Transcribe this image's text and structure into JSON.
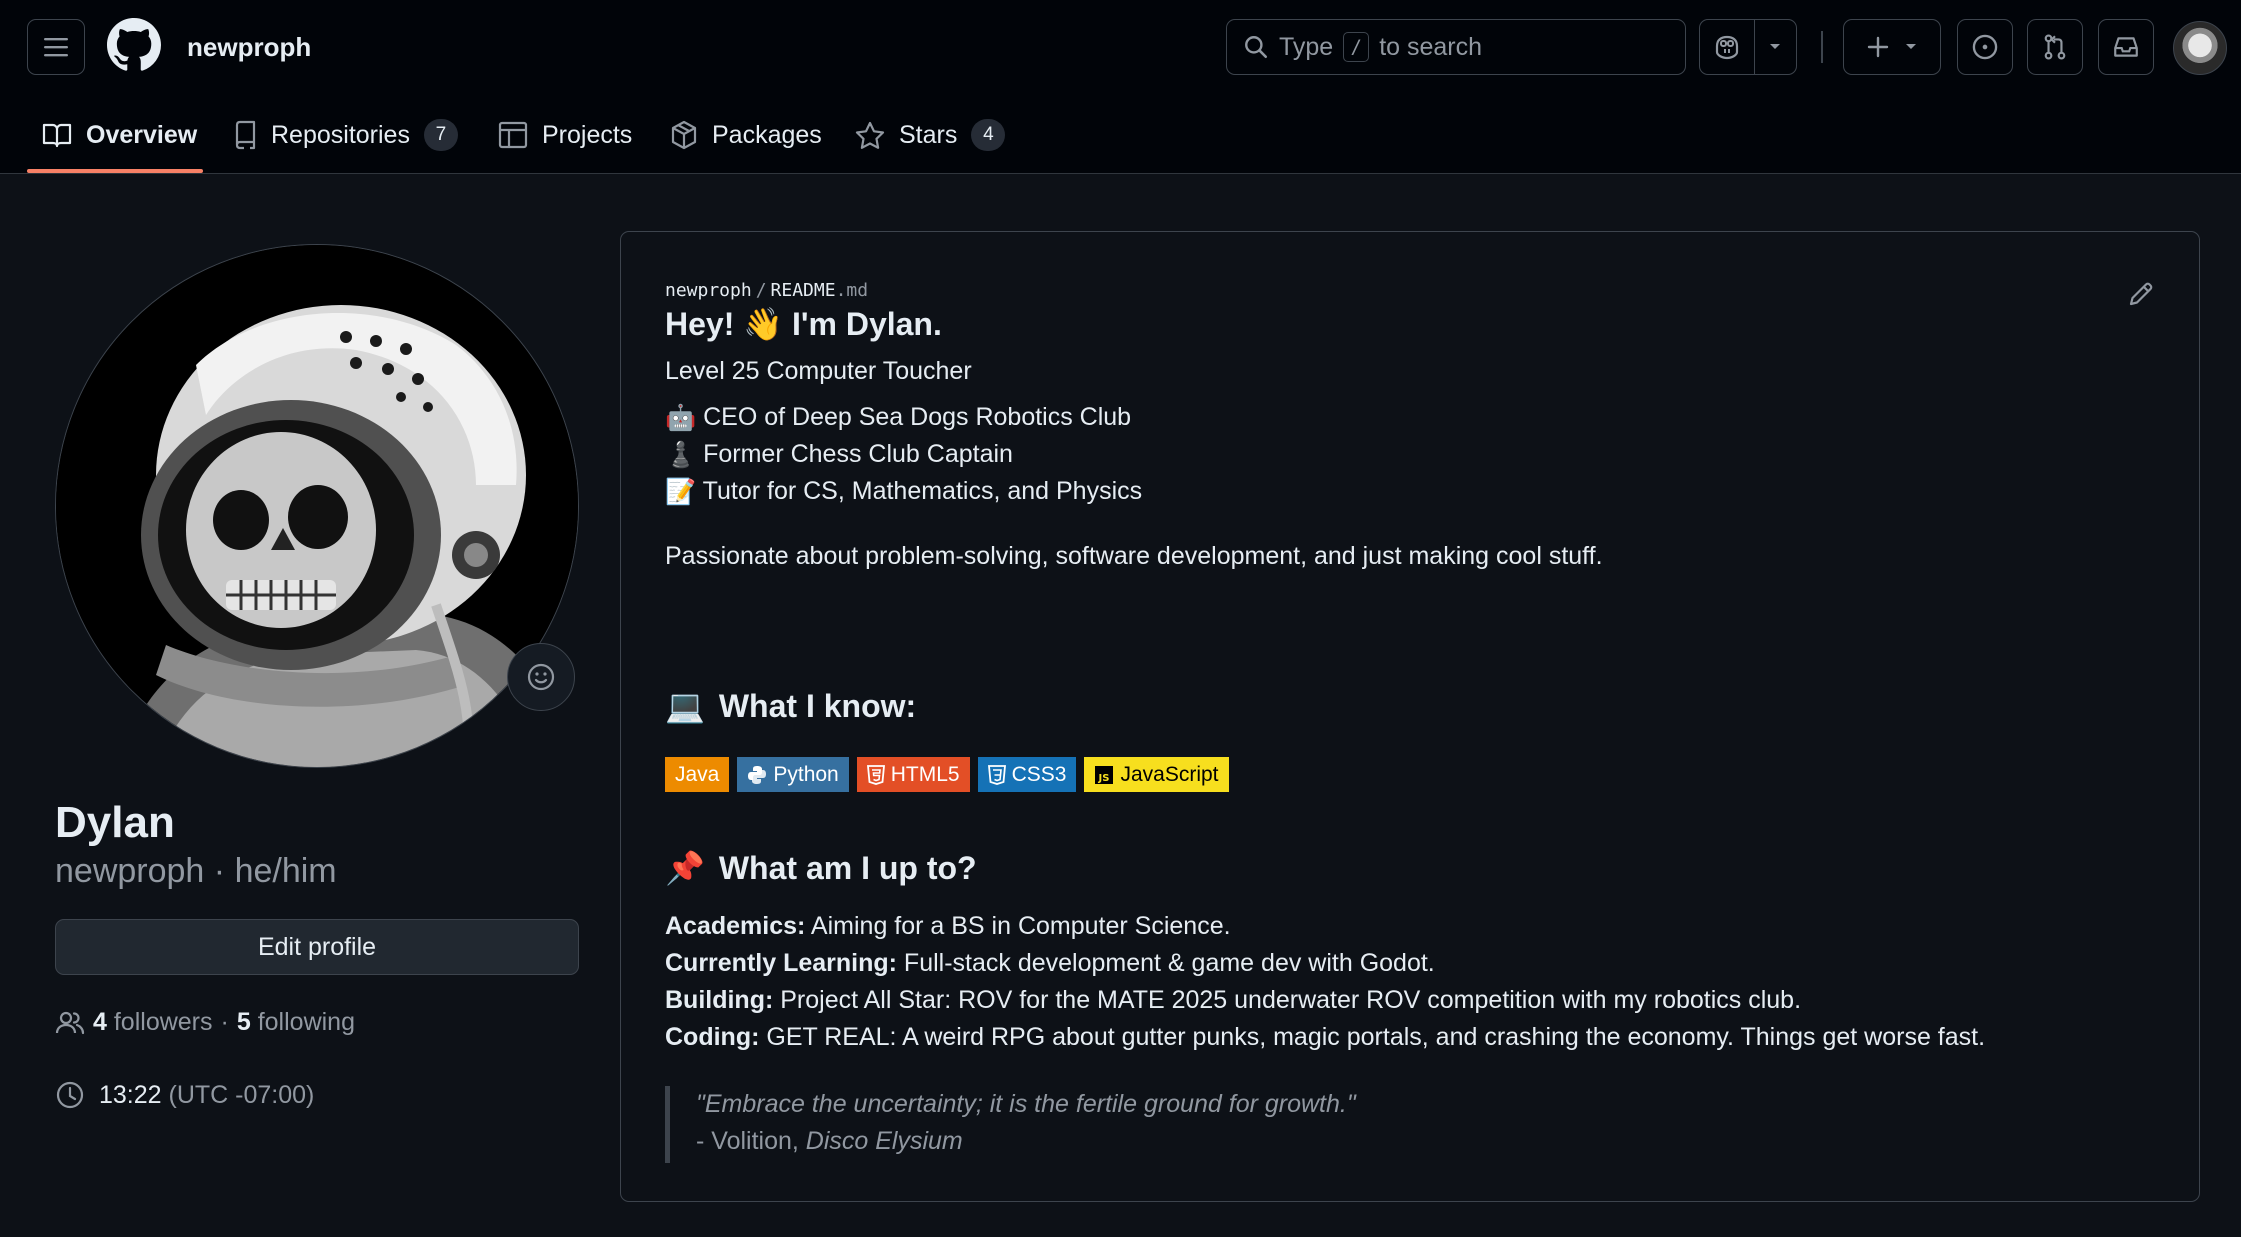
{
  "header": {
    "user_context": "newproph",
    "search": {
      "prefix": "Type",
      "key": "/",
      "suffix": "to search"
    }
  },
  "tabs": [
    {
      "label": "Overview"
    },
    {
      "label": "Repositories",
      "count": "7"
    },
    {
      "label": "Projects"
    },
    {
      "label": "Packages"
    },
    {
      "label": "Stars",
      "count": "4"
    }
  ],
  "profile": {
    "name": "Dylan",
    "login": "newproph",
    "separator": " · ",
    "pronouns": "he/him",
    "edit_label": "Edit profile",
    "followers_count": "4",
    "followers_label": "followers",
    "dot": "·",
    "following_count": "5",
    "following_label": "following",
    "local_time": "13:22",
    "timezone": "(UTC -07:00)"
  },
  "readme": {
    "path_owner": "newproph",
    "path_sep": "/",
    "path_file": "README",
    "path_ext": ".md",
    "heading": "Hey! 👋 I'm Dylan.",
    "tagline": "Level 25 Computer Toucher",
    "roles": [
      {
        "emoji": "🤖",
        "text": "CEO of Deep Sea Dogs Robotics Club"
      },
      {
        "emoji": "♟️",
        "text": "Former Chess Club Captain"
      },
      {
        "emoji": "📝",
        "text": "Tutor for CS, Mathematics, and Physics"
      }
    ],
    "passion": "Passionate about problem-solving, software development, and just making cool stuff.",
    "know_emoji": "💻",
    "know_heading": "What I know:",
    "badges": [
      {
        "label": "Java",
        "color": "#ED8B00"
      },
      {
        "label": "Python",
        "color": "#3670A0"
      },
      {
        "label": "HTML5",
        "color": "#E34F26"
      },
      {
        "label": "CSS3",
        "color": "#1572B6"
      },
      {
        "label": "JavaScript",
        "color": "#F7DF1E"
      }
    ],
    "upto_emoji": "📌",
    "upto_heading": "What am I up to?",
    "items": [
      {
        "key": "Academics:",
        "value": " Aiming for a BS in Computer Science."
      },
      {
        "key": "Currently Learning:",
        "value": " Full-stack development & game dev with Godot."
      },
      {
        "key": "Building:",
        "value": " Project All Star: ROV for the MATE 2025 underwater ROV competition with my robotics club."
      },
      {
        "key": "Coding:",
        "value": " GET REAL: A weird RPG about gutter punks, magic portals, and crashing the economy. Things get worse fast."
      }
    ],
    "quote_text": "\"Embrace the uncertainty; it is the fertile ground for growth.\"",
    "quote_attr_prefix": "- Volition, ",
    "quote_attr_title": "Disco Elysium"
  },
  "colors": {
    "accent_tab": "#f78166",
    "bg": "#0d1117",
    "header_bg": "#010409"
  },
  "icons": [
    "hamburger-icon",
    "github-logo-icon",
    "search-icon",
    "copilot-icon",
    "chevron-down-icon",
    "plus-icon",
    "issues-icon",
    "pull-request-icon",
    "inbox-icon",
    "book-icon",
    "repo-icon",
    "table-icon",
    "package-icon",
    "star-icon",
    "smiley-icon",
    "people-icon",
    "clock-icon",
    "pencil-icon"
  ]
}
